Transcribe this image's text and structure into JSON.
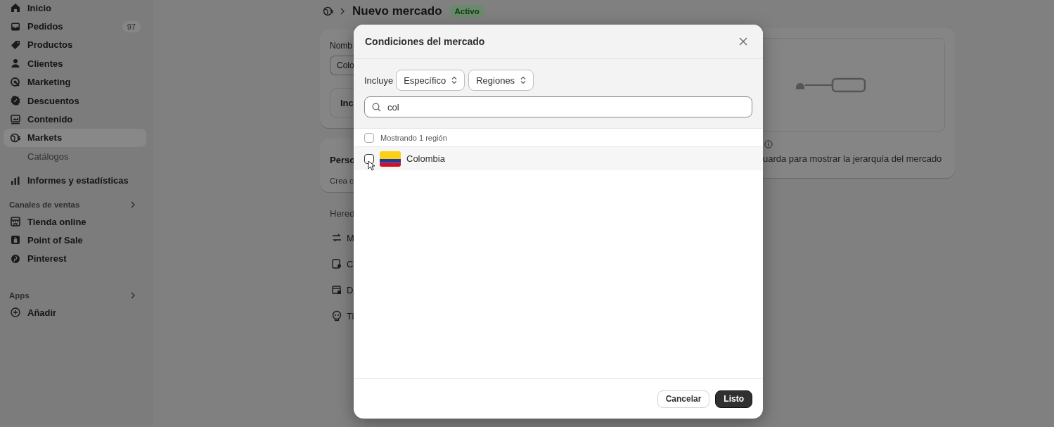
{
  "sidebar": {
    "items": [
      {
        "label": "Inicio",
        "selected": false
      },
      {
        "label": "Pedidos",
        "selected": false,
        "badge": "97"
      },
      {
        "label": "Productos",
        "selected": false
      },
      {
        "label": "Clientes",
        "selected": false
      },
      {
        "label": "Marketing",
        "selected": false
      },
      {
        "label": "Descuentos",
        "selected": false
      },
      {
        "label": "Contenido",
        "selected": false
      },
      {
        "label": "Markets",
        "selected": true,
        "children": [
          {
            "label": "Catálogos",
            "selected": false
          }
        ]
      },
      {
        "label": "Informes y estadísticas",
        "selected": false
      }
    ],
    "sections": [
      {
        "title": "Canales de ventas",
        "items": [
          {
            "label": "Tienda online",
            "selected": false
          },
          {
            "label": "Point of Sale",
            "selected": false
          },
          {
            "label": "Pinterest",
            "selected": false
          }
        ]
      },
      {
        "title": "Apps",
        "items": [
          {
            "label": "Añadir",
            "selected": false
          }
        ]
      }
    ]
  },
  "header": {
    "title": "Nuevo mercado",
    "status": "Activo"
  },
  "name_card": {
    "label": "Nomb",
    "value": "Colo",
    "inner_title": "Inc"
  },
  "personalization_card": {
    "title": "Perso",
    "text": "Crea c"
  },
  "inherited": {
    "title": "Hered",
    "items": [
      "M",
      "C",
      "D",
      "Ti"
    ]
  },
  "hierarchy_card": {
    "note": "uarda para mostrar la jerarquía del mercado"
  },
  "modal": {
    "title": "Condiciones del mercado",
    "include_label": "Incluye",
    "selects": [
      "Específico",
      "Regiones"
    ],
    "search": {
      "value": "col"
    },
    "list": {
      "summary": "Mostrando 1 región",
      "all_checked": false,
      "rows": [
        {
          "label": "Colombia",
          "checked": false,
          "highlighted": true
        }
      ]
    },
    "buttons": [
      {
        "label": "Cancelar",
        "kind": "secondary"
      },
      {
        "label": "Listo",
        "kind": "primary"
      }
    ]
  }
}
